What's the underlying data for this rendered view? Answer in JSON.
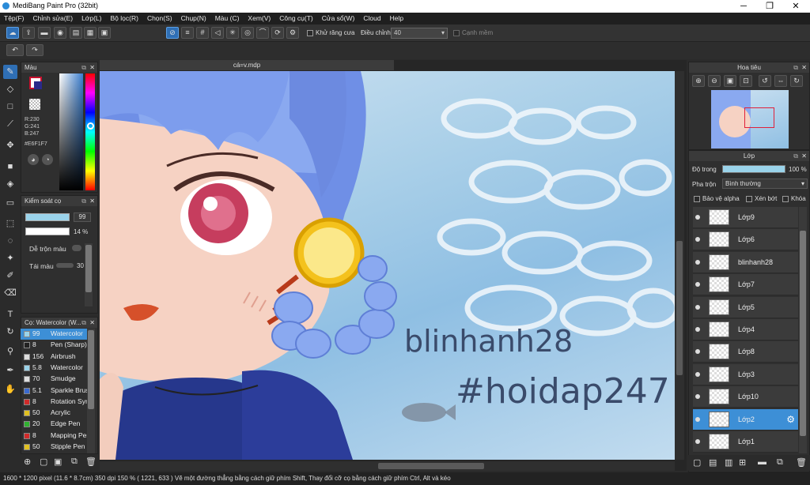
{
  "window": {
    "title": "MediBang Paint Pro (32bit)"
  },
  "menu": [
    "Tệp(F)",
    "Chỉnh sửa(E)",
    "Lớp(L)",
    "Bộ lọc(R)",
    "Chọn(S)",
    "Chụp(N)",
    "Màu (C)",
    "Xem(V)",
    "Công cụ(T)",
    "Cửa sổ(W)",
    "Cloud",
    "Help"
  ],
  "toolbar": {
    "antialias_label": "Khử răng cưa",
    "adjust_label": "Điều chỉnh",
    "adjust_value": "40",
    "smooth_label": "Cạnh mềm"
  },
  "canvas": {
    "filename": "cá=v.mdp",
    "text_line1": "blinhanh28",
    "text_line2": "#hoidap247"
  },
  "color_panel": {
    "title": "Màu",
    "r": "R:230",
    "g": "G:241",
    "b": "B:247",
    "hex": "#E6F1F7",
    "fg_color": "#c8102e",
    "bg_color": "#e6f1f7"
  },
  "brush_control": {
    "title": "Kiểm soát cọ",
    "size_value": "99",
    "opacity_value": "14 %",
    "blend_label": "Dễ trộn màu",
    "reuse_label": "Tái màu",
    "reuse_value": "30"
  },
  "brush_list": {
    "title": "Cọ: Watercolor (W...",
    "items": [
      {
        "size": "99",
        "name": "Watercolor",
        "color": "#9ad3ea",
        "selected": true
      },
      {
        "size": "8",
        "name": "Pen (Sharp)",
        "color": "#222222"
      },
      {
        "size": "156",
        "name": "Airbrush",
        "color": "#dddddd"
      },
      {
        "size": "5.8",
        "name": "Watercolor",
        "color": "#9ad3ea"
      },
      {
        "size": "70",
        "name": "Smudge",
        "color": "#dddddd"
      },
      {
        "size": "5.1",
        "name": "Sparkle Brush",
        "color": "#3a6ad0"
      },
      {
        "size": "8",
        "name": "Rotation Sym",
        "color": "#d02a2a"
      },
      {
        "size": "50",
        "name": "Acrylic",
        "color": "#e0c020"
      },
      {
        "size": "20",
        "name": "Edge Pen",
        "color": "#30b030"
      },
      {
        "size": "8",
        "name": "Mapping Pen",
        "color": "#d02a2a"
      },
      {
        "size": "50",
        "name": "Stipple Pen",
        "color": "#e0c020"
      }
    ]
  },
  "navigator": {
    "title": "Hoa tiêu"
  },
  "layers": {
    "title": "Lớp",
    "opacity_label": "Độ trong",
    "opacity_value": "100 %",
    "blend_label": "Pha trộn",
    "blend_value": "Bình thường",
    "protect_alpha": "Bảo vệ alpha",
    "clipping": "Xén bớt",
    "lock": "Khóa",
    "items": [
      {
        "name": "Lớp9"
      },
      {
        "name": "Lớp6"
      },
      {
        "name": "blinhanh28"
      },
      {
        "name": "Lớp7"
      },
      {
        "name": "Lớp5"
      },
      {
        "name": "Lớp4"
      },
      {
        "name": "Lớp8"
      },
      {
        "name": "Lớp3"
      },
      {
        "name": "Lớp10"
      },
      {
        "name": "Lớp2",
        "selected": true
      },
      {
        "name": "Lớp1"
      }
    ]
  },
  "status": {
    "text": "1600 * 1200 pixel  (11.6 * 8.7cm)  350 dpi  150 %  ( 1221, 633 )  Vẽ một đường thẳng bằng cách giữ phím Shift, Thay đổi cỡ cọ bằng cách giữ phím Ctrl, Alt và kéo"
  }
}
